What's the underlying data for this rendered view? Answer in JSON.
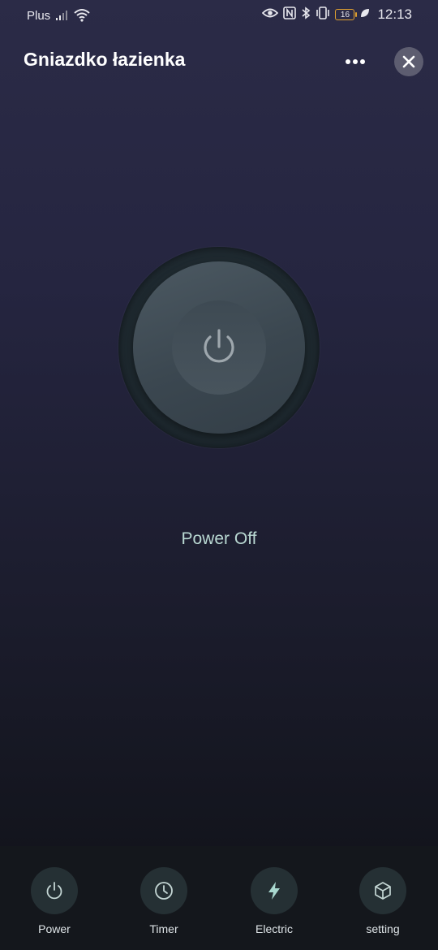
{
  "status_bar": {
    "carrier": "Plus",
    "battery_level": "16",
    "time": "12:13"
  },
  "header": {
    "title": "Gniazdko łazienka"
  },
  "power": {
    "state_text": "Power Off"
  },
  "bottom_nav": {
    "items": [
      {
        "label": "Power",
        "icon": "power-icon"
      },
      {
        "label": "Timer",
        "icon": "clock-icon"
      },
      {
        "label": "Electric",
        "icon": "lightning-icon"
      },
      {
        "label": "setting",
        "icon": "cube-icon"
      }
    ]
  },
  "colors": {
    "accent": "#b9d8d2",
    "battery": "#e0a030"
  }
}
